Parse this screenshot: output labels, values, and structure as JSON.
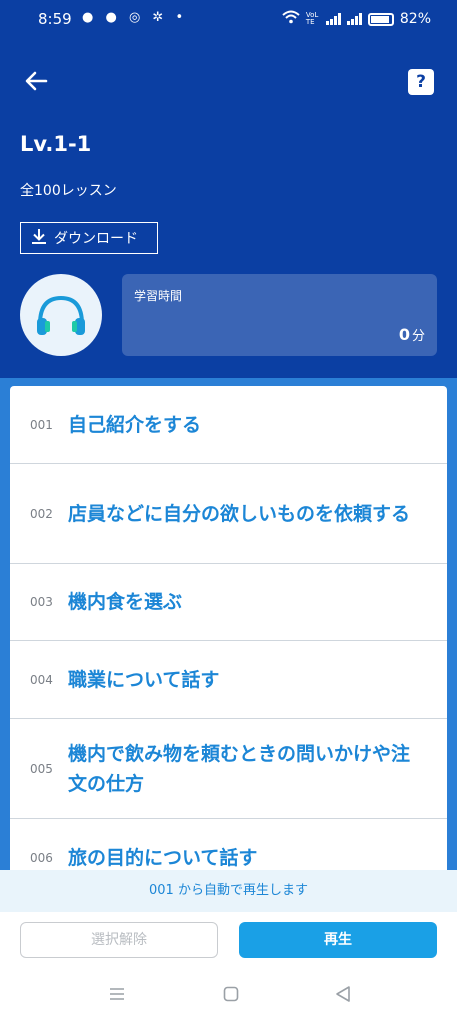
{
  "status_bar": {
    "time": "8:59",
    "notifications": "● ● ◎ ✲ •",
    "network_label": "VoLTE",
    "battery": "82%"
  },
  "header": {
    "title": "Lv.1-1",
    "subtitle": "全100レッスン",
    "download_label": "ダウンロード",
    "help_label": "?"
  },
  "study_time": {
    "label": "学習時間",
    "value": "0",
    "unit": "分"
  },
  "lessons": [
    {
      "num": "001",
      "title": "自己紹介をする"
    },
    {
      "num": "002",
      "title": "店員などに自分の欲しいものを依頼する"
    },
    {
      "num": "003",
      "title": "機内食を選ぶ"
    },
    {
      "num": "004",
      "title": "職業について話す"
    },
    {
      "num": "005",
      "title": "機内で飲み物を頼むときの問いかけや注文の仕方"
    },
    {
      "num": "006",
      "title": "旅の目的について話す"
    }
  ],
  "autoplay_notice": "001 から自動で再生します",
  "buttons": {
    "clear_selection": "選択解除",
    "play": "再生"
  },
  "colors": {
    "header_bg": "#0b3fa3",
    "body_bg": "#2b7fd6",
    "accent": "#1c86d6",
    "play_button": "#1aa0e6"
  }
}
